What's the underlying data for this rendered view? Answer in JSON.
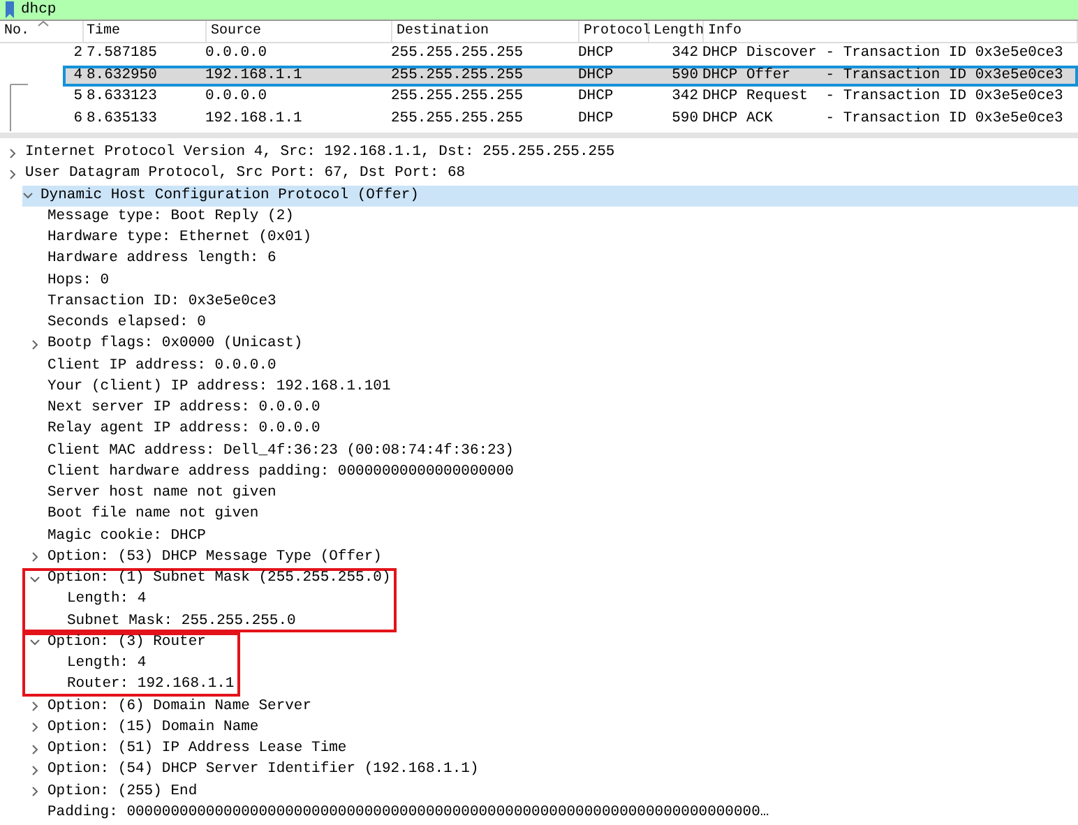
{
  "filter": {
    "value": "dhcp"
  },
  "packet_list": {
    "columns": [
      "No.",
      "Time",
      "Source",
      "Destination",
      "Protocol",
      "Length",
      "Info"
    ],
    "rows": [
      {
        "no": "2",
        "time": "7.587185",
        "source": "0.0.0.0",
        "destination": "255.255.255.255",
        "protocol": "DHCP",
        "length": "342",
        "info": "DHCP Discover - Transaction ID 0x3e5e0ce3",
        "selected": false
      },
      {
        "no": "4",
        "time": "8.632950",
        "source": "192.168.1.1",
        "destination": "255.255.255.255",
        "protocol": "DHCP",
        "length": "590",
        "info": "DHCP Offer    - Transaction ID 0x3e5e0ce3",
        "selected": true
      },
      {
        "no": "5",
        "time": "8.633123",
        "source": "0.0.0.0",
        "destination": "255.255.255.255",
        "protocol": "DHCP",
        "length": "342",
        "info": "DHCP Request  - Transaction ID 0x3e5e0ce3",
        "selected": false
      },
      {
        "no": "6",
        "time": "8.635133",
        "source": "192.168.1.1",
        "destination": "255.255.255.255",
        "protocol": "DHCP",
        "length": "590",
        "info": "DHCP ACK      - Transaction ID 0x3e5e0ce3",
        "selected": false
      }
    ]
  },
  "details": [
    {
      "label": "Internet Protocol Version 4, Src: 192.168.1.1, Dst: 255.255.255.255",
      "expanded": false,
      "selected": false
    },
    {
      "label": "User Datagram Protocol, Src Port: 67, Dst Port: 68",
      "expanded": false,
      "selected": false
    },
    {
      "label": "Dynamic Host Configuration Protocol (Offer)",
      "expanded": true,
      "selected": true,
      "children": [
        {
          "label": "Message type: Boot Reply (2)"
        },
        {
          "label": "Hardware type: Ethernet (0x01)"
        },
        {
          "label": "Hardware address length: 6"
        },
        {
          "label": "Hops: 0"
        },
        {
          "label": "Transaction ID: 0x3e5e0ce3"
        },
        {
          "label": "Seconds elapsed: 0"
        },
        {
          "label": "Bootp flags: 0x0000 (Unicast)",
          "expanded": false
        },
        {
          "label": "Client IP address: 0.0.0.0"
        },
        {
          "label": "Your (client) IP address: 192.168.1.101"
        },
        {
          "label": "Next server IP address: 0.0.0.0"
        },
        {
          "label": "Relay agent IP address: 0.0.0.0"
        },
        {
          "label": "Client MAC address: Dell_4f:36:23 (00:08:74:4f:36:23)"
        },
        {
          "label": "Client hardware address padding: 00000000000000000000"
        },
        {
          "label": "Server host name not given"
        },
        {
          "label": "Boot file name not given"
        },
        {
          "label": "Magic cookie: DHCP"
        },
        {
          "label": "Option: (53) DHCP Message Type (Offer)",
          "expanded": false
        },
        {
          "label": "Option: (1) Subnet Mask (255.255.255.0)",
          "expanded": true,
          "annotated": true,
          "children": [
            {
              "label": "Length: 4"
            },
            {
              "label": "Subnet Mask: 255.255.255.0"
            }
          ]
        },
        {
          "label": "Option: (3) Router",
          "expanded": true,
          "annotated": true,
          "children": [
            {
              "label": "Length: 4"
            },
            {
              "label": "Router: 192.168.1.1"
            }
          ]
        },
        {
          "label": "Option: (6) Domain Name Server",
          "expanded": false
        },
        {
          "label": "Option: (15) Domain Name",
          "expanded": false
        },
        {
          "label": "Option: (51) IP Address Lease Time",
          "expanded": false
        },
        {
          "label": "Option: (54) DHCP Server Identifier (192.168.1.1)",
          "expanded": false
        },
        {
          "label": "Option: (255) End",
          "expanded": false
        },
        {
          "label": "Padding: 000000000000000000000000000000000000000000000000000000000000000000000000…"
        }
      ]
    }
  ]
}
